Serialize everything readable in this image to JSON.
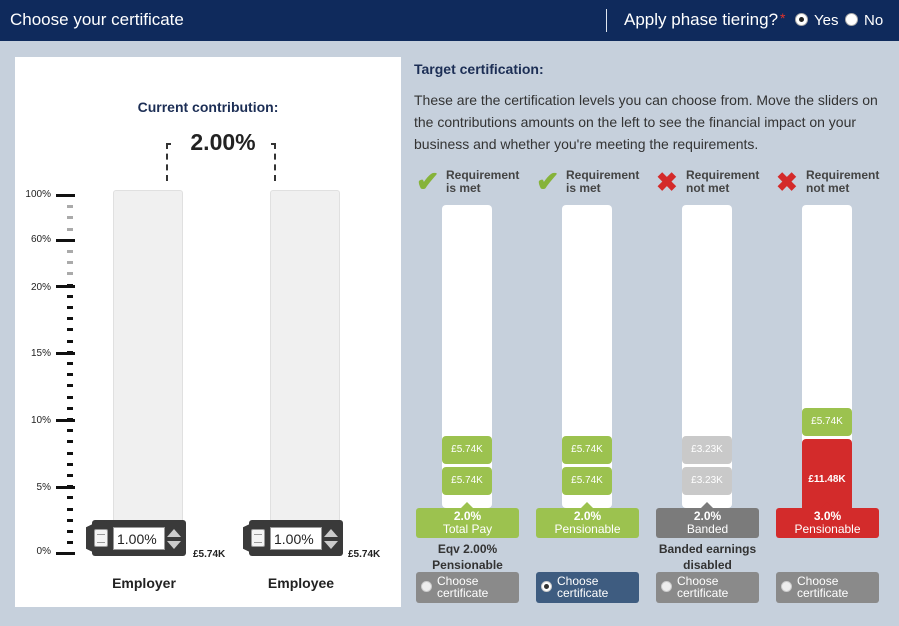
{
  "header": {
    "title": "Choose your certificate",
    "tiering_question": "Apply phase tiering?",
    "required_mark": "*",
    "yes_label": "Yes",
    "no_label": "No",
    "selected": "Yes"
  },
  "contribution": {
    "title": "Current contribution:",
    "value": "2.00%",
    "scale_labels": [
      "100%",
      "60%",
      "20%",
      "15%",
      "10%",
      "5%",
      "0%"
    ],
    "employer": {
      "label": "Employer",
      "value": "1.00%",
      "amount": "£5.74K"
    },
    "employee": {
      "label": "Employee",
      "value": "1.00%",
      "amount": "£5.74K"
    }
  },
  "target": {
    "title": "Target certification:",
    "description": "These are the certification levels you can choose from. Move the sliders on the contributions amounts on the left to see the financial impact on your business and whether you're meeting the requirements.",
    "certificates": [
      {
        "req_line1": "Requirement",
        "req_line2": "is met",
        "status": "met",
        "amount_top": "£5.74K",
        "amount_bottom": "£5.74K",
        "pct": "2.0%",
        "basis": "Total Pay",
        "note_line1": "Eqv 2.00%",
        "note_line2": "Pensionable",
        "choose_line1": "Choose",
        "choose_line2": "certificate",
        "selected": false
      },
      {
        "req_line1": "Requirement",
        "req_line2": "is met",
        "status": "met",
        "amount_top": "£5.74K",
        "amount_bottom": "£5.74K",
        "pct": "2.0%",
        "basis": "Pensionable",
        "note_line1": "",
        "note_line2": "",
        "choose_line1": "Choose",
        "choose_line2": "certificate",
        "selected": true
      },
      {
        "req_line1": "Requirement",
        "req_line2": "not met",
        "status": "not met",
        "amount_top": "£3.23K",
        "amount_bottom": "£3.23K",
        "pct": "2.0%",
        "basis": "Banded",
        "note_line1": "Banded earnings",
        "note_line2": "disabled",
        "choose_line1": "Choose",
        "choose_line2": "certificate",
        "selected": false
      },
      {
        "req_line1": "Requirement",
        "req_line2": "not met",
        "status": "not met",
        "amount_top": "£5.74K",
        "amount_bottom": "£11.48K",
        "pct": "3.0%",
        "basis": "Pensionable",
        "note_line1": "",
        "note_line2": "",
        "choose_line1": "Choose",
        "choose_line2": "certificate",
        "selected": false
      }
    ]
  },
  "colors": {
    "header_bg": "#0f2a5c",
    "page_bg": "#c6d0dc",
    "met_green": "#9cc24f",
    "fail_red": "#d32b2b",
    "neutral_grey": "#7b7b7b",
    "selected_blue": "#3e5c80"
  },
  "icons": [
    "check-icon",
    "cross-icon",
    "grip-icon",
    "spinner-up-icon",
    "spinner-down-icon"
  ]
}
